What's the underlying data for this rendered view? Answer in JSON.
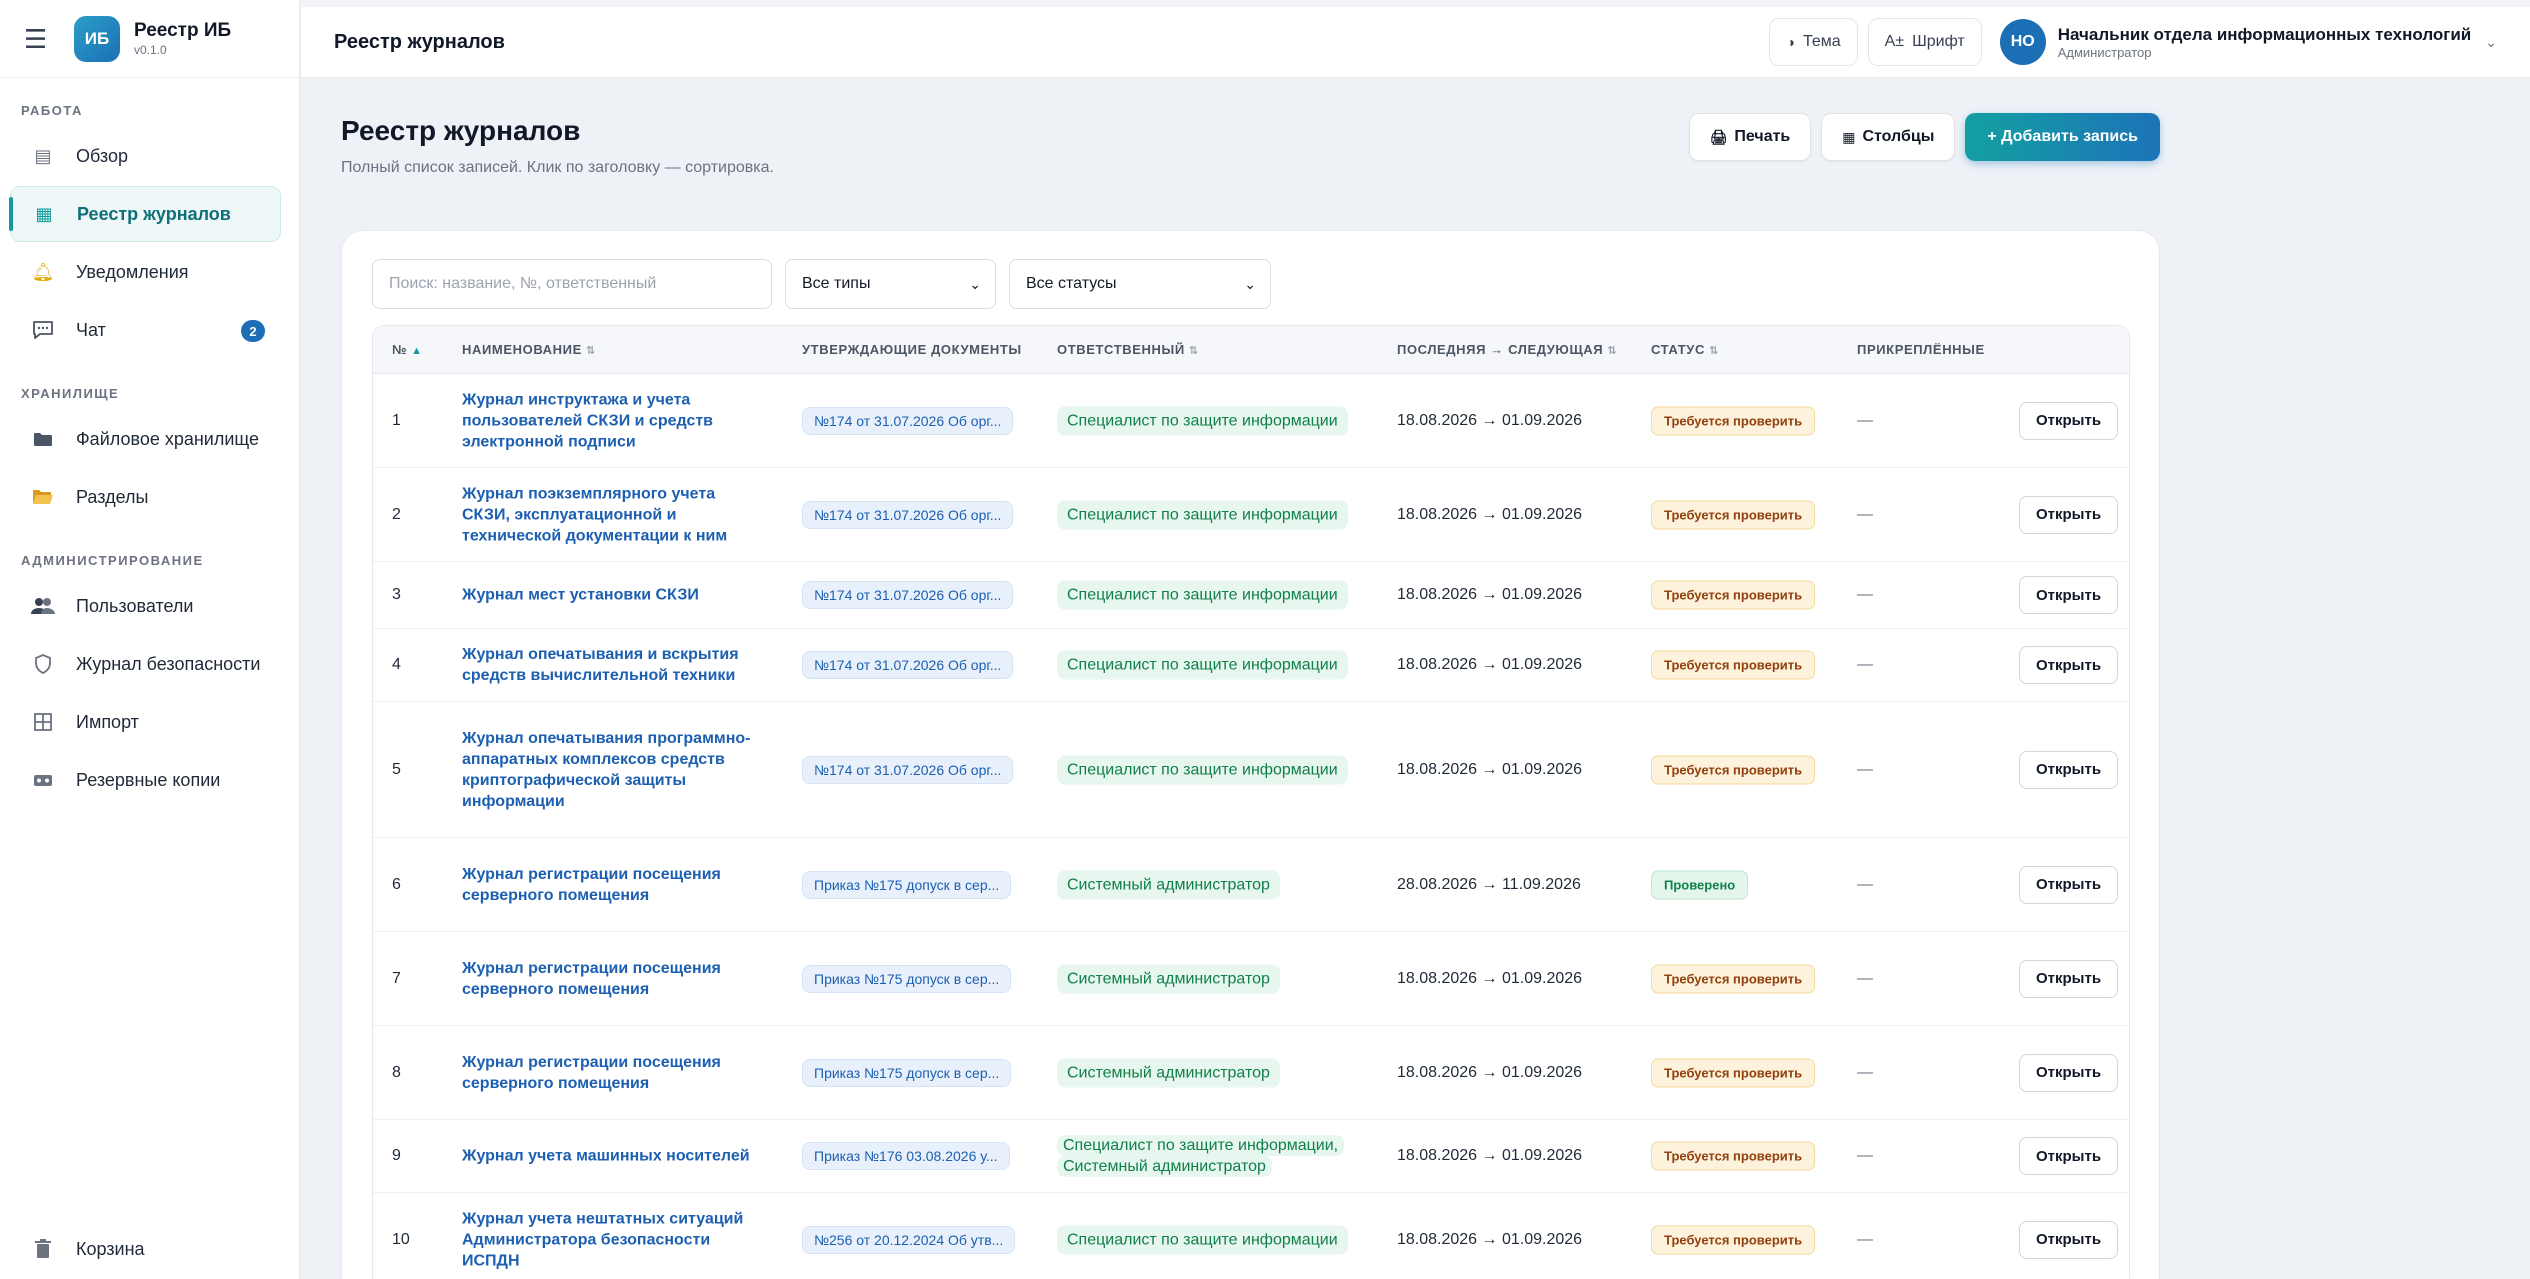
{
  "sidebar": {
    "brand": {
      "logo": "ИБ",
      "name": "Реестр ИБ",
      "version": "v0.1.0"
    },
    "sections": [
      {
        "title": "РАБОТА",
        "items": [
          {
            "label": "Обзор",
            "icon": "dashboard-icon"
          },
          {
            "label": "Реестр журналов",
            "icon": "grid-icon",
            "active": true
          },
          {
            "label": "Уведомления",
            "icon": "bell-icon"
          },
          {
            "label": "Чат",
            "icon": "chat-icon",
            "badge": "2"
          }
        ]
      },
      {
        "title": "ХРАНИЛИЩЕ",
        "items": [
          {
            "label": "Файловое хранилище",
            "icon": "folder-icon"
          },
          {
            "label": "Разделы",
            "icon": "open-folder-icon"
          }
        ]
      },
      {
        "title": "АДМИНИСТРИРОВАНИЕ",
        "items": [
          {
            "label": "Пользователи",
            "icon": "users-icon"
          },
          {
            "label": "Журнал безопасности",
            "icon": "shield-icon"
          },
          {
            "label": "Импорт",
            "icon": "import-icon"
          },
          {
            "label": "Резервные копии",
            "icon": "backup-icon"
          }
        ]
      }
    ],
    "trash": {
      "label": "Корзина",
      "icon": "trash-icon"
    }
  },
  "topbar": {
    "title": "Реестр журналов",
    "theme_label": "Тема",
    "font_label": "Шрифт",
    "user": {
      "initials": "НО",
      "name": "Начальник отдела информационных технологий",
      "role": "Администратор"
    }
  },
  "page": {
    "title": "Реестр журналов",
    "subtitle": "Полный список записей. Клик по заголовку — сортировка.",
    "print_label": "Печать",
    "columns_label": "Столбцы",
    "add_label": "+ Добавить запись"
  },
  "filters": {
    "search_placeholder": "Поиск: название, №, ответственный",
    "type_value": "Все типы",
    "status_value": "Все статусы"
  },
  "table": {
    "headers": {
      "num": "№",
      "name": "НАИМЕНОВАНИЕ",
      "docs": "УТВЕРЖДАЮЩИЕ ДОКУМЕНТЫ",
      "resp": "ОТВЕТСТВЕННЫЙ",
      "dates": "ПОСЛЕДНЯЯ → СЛЕДУЮЩАЯ",
      "status": "СТАТУС",
      "att": "ПРИКРЕПЛЁННЫЕ"
    },
    "open_label": "Открыть",
    "rows": [
      {
        "num": "1",
        "name": "Журнал инструктажа и учета пользователей СКЗИ и средств электронной подписи",
        "doc": "№174 от 31.07.2026 Об орг...",
        "resp": "Специалист по защите информации",
        "dates": "18.08.2026 → 01.09.2026",
        "status": "Требуется проверить",
        "status_kind": "warn",
        "att": "—"
      },
      {
        "num": "2",
        "name": "Журнал поэкземплярного учета СКЗИ, эксплуатационной и технической документации к ним",
        "doc": "№174 от 31.07.2026 Об орг...",
        "resp": "Специалист по защите информации",
        "dates": "18.08.2026 → 01.09.2026",
        "status": "Требуется проверить",
        "status_kind": "warn",
        "att": "—"
      },
      {
        "num": "3",
        "name": "Журнал мест установки СКЗИ",
        "doc": "№174 от 31.07.2026 Об орг...",
        "resp": "Специалист по защите информации",
        "dates": "18.08.2026 → 01.09.2026",
        "status": "Требуется проверить",
        "status_kind": "warn",
        "att": "—"
      },
      {
        "num": "4",
        "name": "Журнал опечатывания и вскрытия средств вычислительной техники",
        "doc": "№174 от 31.07.2026 Об орг...",
        "resp": "Специалист по защите информации",
        "dates": "18.08.2026 → 01.09.2026",
        "status": "Требуется проверить",
        "status_kind": "warn",
        "att": "—"
      },
      {
        "num": "5",
        "name": "Журнал опечатывания программно-аппаратных комплексов средств криптографической защиты информации",
        "doc": "№174 от 31.07.2026 Об орг...",
        "resp": "Специалист по защите информации",
        "dates": "18.08.2026 → 01.09.2026",
        "status": "Требуется проверить",
        "status_kind": "warn",
        "att": "—"
      },
      {
        "num": "6",
        "name": "Журнал регистрации посещения серверного помещения",
        "doc": "Приказ №175 допуск в сер...",
        "resp": "Системный администратор",
        "dates": "28.08.2026 → 11.09.2026",
        "status": "Проверено",
        "status_kind": "ok",
        "att": "—"
      },
      {
        "num": "7",
        "name": "Журнал регистрации посещения серверного помещения",
        "doc": "Приказ №175 допуск в сер...",
        "resp": "Системный администратор",
        "dates": "18.08.2026 → 01.09.2026",
        "status": "Требуется проверить",
        "status_kind": "warn",
        "att": "—"
      },
      {
        "num": "8",
        "name": "Журнал регистрации посещения серверного помещения",
        "doc": "Приказ №175 допуск в сер...",
        "resp": "Системный администратор",
        "dates": "18.08.2026 → 01.09.2026",
        "status": "Требуется проверить",
        "status_kind": "warn",
        "att": "—"
      },
      {
        "num": "9",
        "name": "Журнал учета машинных носителей",
        "doc": "Приказ №176 03.08.2026 у...",
        "resp": "Специалист по защите информации, Системный администратор",
        "dates": "18.08.2026 → 01.09.2026",
        "status": "Требуется проверить",
        "status_kind": "warn",
        "att": "—"
      },
      {
        "num": "10",
        "name": "Журнал учета нештатных ситуаций Администратора безопасности ИСПДН",
        "doc": "№256 от 20.12.2024 Об утв...",
        "resp": "Специалист по защите информации",
        "dates": "18.08.2026 → 01.09.2026",
        "status": "Требуется проверить",
        "status_kind": "warn",
        "att": "—"
      }
    ]
  },
  "colors": {
    "accent": "#129a9c",
    "primary": "#1d6fb5",
    "link": "#1d5fb0"
  }
}
